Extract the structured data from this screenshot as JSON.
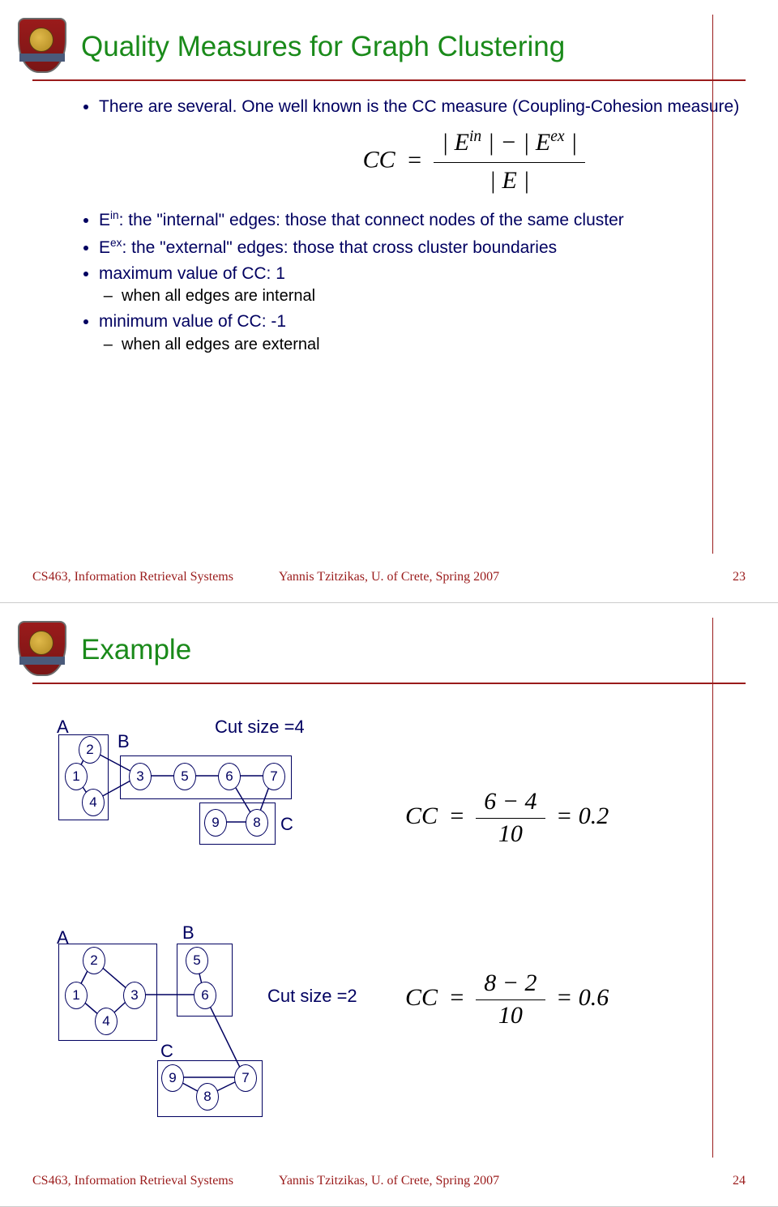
{
  "slide1": {
    "title": "Quality Measures for Graph Clustering",
    "bullets": {
      "b1": "There are several. One well known is the CC measure (Coupling-Cohesion measure)",
      "b2_pre": "E",
      "b2_sup": "in",
      "b2_rest": ": the \"internal\" edges: those that connect nodes of the same cluster",
      "b3_pre": "E",
      "b3_sup": "ex",
      "b3_rest": ": the \"external\" edges: those that cross cluster boundaries",
      "b4": "maximum value of CC:  1",
      "b4s": "when all edges are internal",
      "b5": "minimum value of CC: -1",
      "b5s": "when all edges are external"
    },
    "formula": {
      "lhs": "CC",
      "num_a": "| E",
      "num_a_sup": "in",
      "num_mid": " | − | E",
      "num_b_sup": "ex",
      "num_end": " |",
      "den": "| E |"
    },
    "footer": {
      "left": "CS463, Information Retrieval Systems",
      "mid": "Yannis Tzitzikas, U. of Crete, Spring  2007",
      "page": "23"
    }
  },
  "slide2": {
    "title": "Example",
    "d1": {
      "A": "A",
      "B": "B",
      "C": "C",
      "n1": "1",
      "n2": "2",
      "n3": "3",
      "n4": "4",
      "n5": "5",
      "n6": "6",
      "n7": "7",
      "n8": "8",
      "n9": "9",
      "cut": "Cut size =4",
      "cc_lhs": "CC",
      "cc_num": "6 − 4",
      "cc_den": "10",
      "cc_val": "= 0.2"
    },
    "d2": {
      "A": "A",
      "B": "B",
      "C": "C",
      "n1": "1",
      "n2": "2",
      "n3": "3",
      "n4": "4",
      "n5": "5",
      "n6": "6",
      "n7": "7",
      "n8": "8",
      "n9": "9",
      "cut": "Cut size =2",
      "cc_lhs": "CC",
      "cc_num": "8 − 2",
      "cc_den": "10",
      "cc_val": "= 0.6"
    },
    "footer": {
      "left": "CS463, Information Retrieval Systems",
      "mid": "Yannis Tzitzikas, U. of Crete, Spring  2007",
      "page": "24"
    }
  }
}
